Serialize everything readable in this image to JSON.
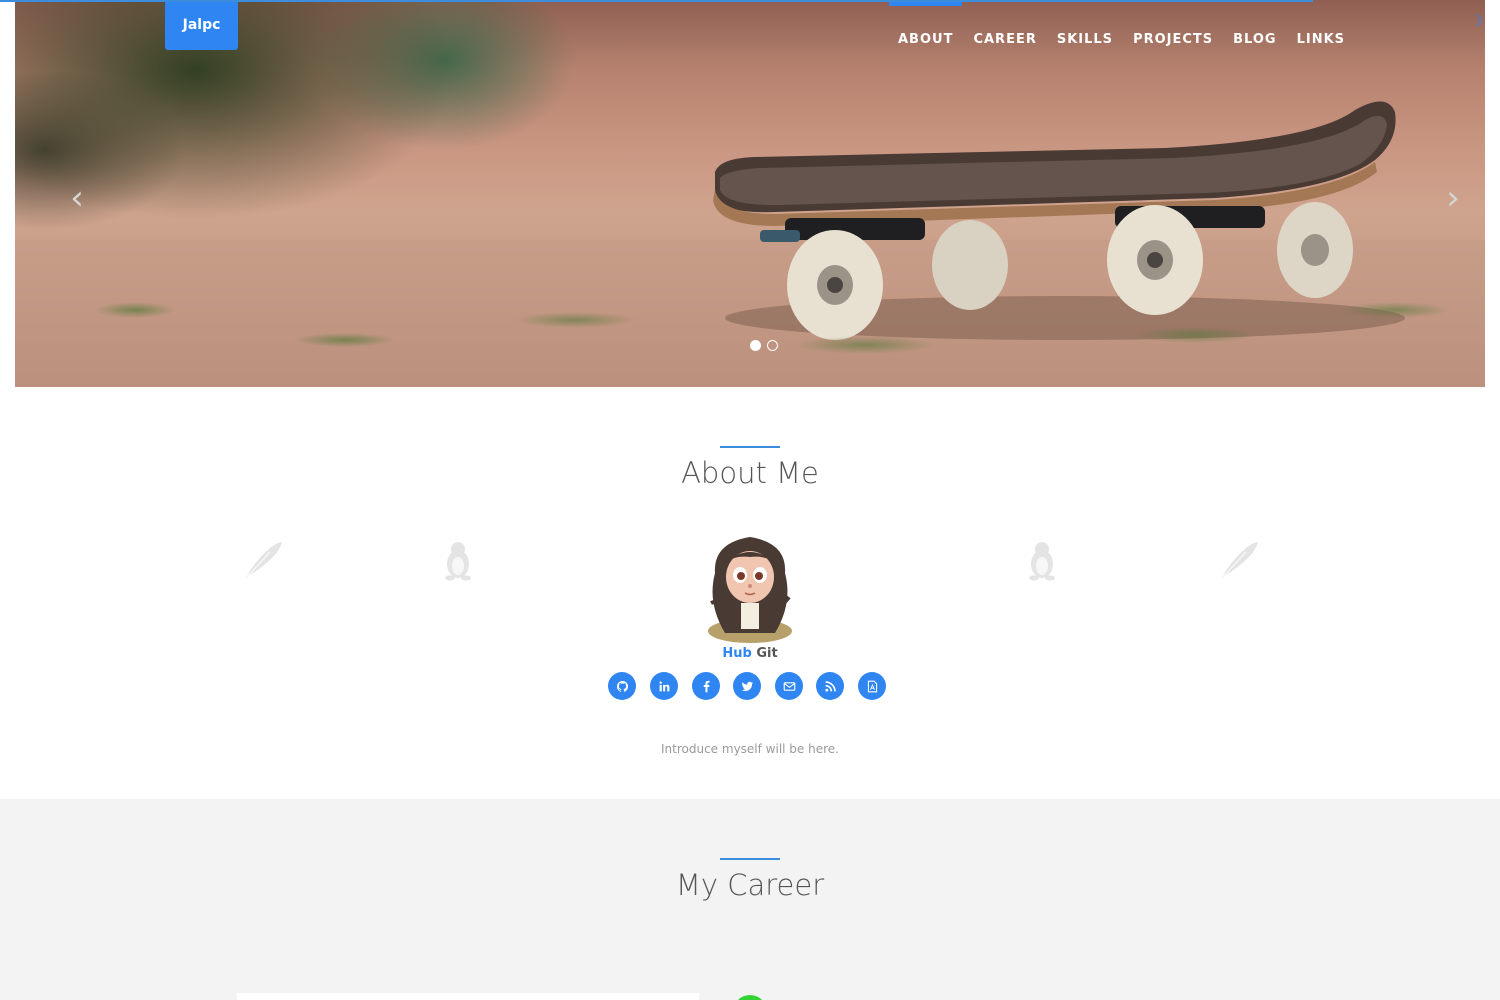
{
  "brand": {
    "label": "Jalpc"
  },
  "nav": {
    "items": [
      {
        "label": "ABOUT",
        "active": true
      },
      {
        "label": "CAREER",
        "active": false
      },
      {
        "label": "SKILLS",
        "active": false
      },
      {
        "label": "PROJECTS",
        "active": false
      },
      {
        "label": "BLOG",
        "active": false
      },
      {
        "label": "LINKS",
        "active": false
      }
    ]
  },
  "carousel": {
    "prev_icon": "chevron-left-icon",
    "next_icon": "chevron-right-icon",
    "slide_count": 2,
    "active_index": 0
  },
  "about": {
    "title": "About Me",
    "name_first": "Hub",
    "name_last": "Git",
    "intro": "Introduce myself will be here.",
    "socials": [
      "github-icon",
      "linkedin-icon",
      "facebook-icon",
      "twitter-icon",
      "email-icon",
      "rss-icon",
      "pdf-icon"
    ]
  },
  "career": {
    "title": "My Career"
  },
  "colors": {
    "accent": "#2f86f2",
    "section_bg": "#f3f3f3",
    "title": "#555555",
    "muted": "#9a9a9a"
  }
}
